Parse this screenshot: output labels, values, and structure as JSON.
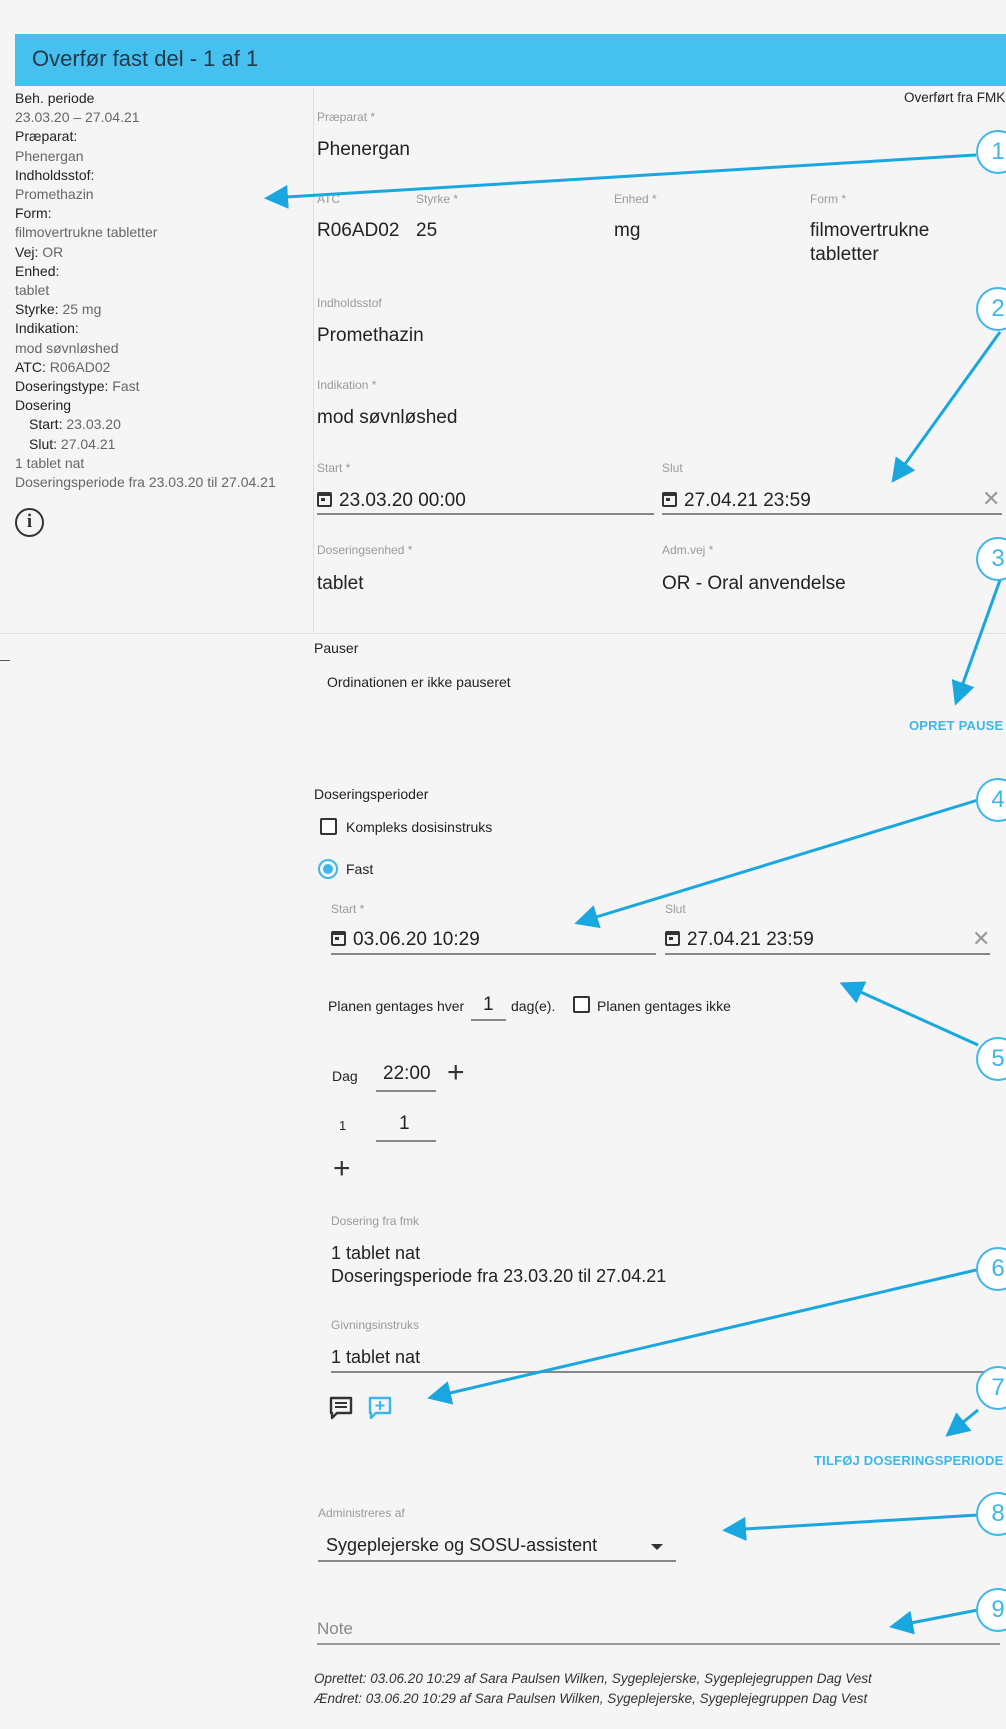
{
  "header": {
    "title": "Overfør fast del - 1 af 1"
  },
  "summary": {
    "beh_periode_label": "Beh. periode",
    "beh_periode_value": "23.03.20 – 27.04.21",
    "praeparat_label": "Præparat:",
    "praeparat_value": "Phenergan",
    "indholdsstof_label": "Indholdsstof:",
    "indholdsstof_value": "Promethazin",
    "form_label": "Form:",
    "form_value": "filmovertrukne tabletter",
    "vej_label": "Vej:",
    "vej_value": "OR",
    "enhed_label": "Enhed:",
    "enhed_value": "tablet",
    "styrke_label": "Styrke:",
    "styrke_value": "25 mg",
    "indikation_label": "Indikation:",
    "indikation_value": "mod søvnløshed",
    "atc_label": "ATC:",
    "atc_value": "R06AD02",
    "doseringstype_label": "Doseringstype:",
    "doseringstype_value": "Fast",
    "dosering_label": "Dosering",
    "start_label": "Start:",
    "start_value": "23.03.20",
    "slut_label": "Slut:",
    "slut_value": "27.04.21",
    "line1": "1 tablet nat",
    "line2": "Doseringsperiode fra 23.03.20 til 27.04.21"
  },
  "form": {
    "source_note": "Overført fra FMK",
    "praeparat_label": "Præparat *",
    "praeparat_value": "Phenergan",
    "atc_label": "ATC",
    "atc_value": "R06AD02",
    "styrke_label": "Styrke *",
    "styrke_value": "25",
    "enhed_label": "Enhed *",
    "enhed_value": "mg",
    "form_label": "Form *",
    "form_value_1": "filmovertrukne",
    "form_value_2": "tabletter",
    "indholdsstof_label": "Indholdsstof",
    "indholdsstof_value": "Promethazin",
    "indikation_label": "Indikation *",
    "indikation_value": "mod søvnløshed",
    "start_label": "Start *",
    "start_value": "23.03.20 00:00",
    "slut_label": "Slut",
    "slut_value": "27.04.21 23:59",
    "doseringsenhed_label": "Doseringsenhed *",
    "doseringsenhed_value": "tablet",
    "admvej_label": "Adm.vej *",
    "admvej_value": "OR - Oral anvendelse"
  },
  "pauser": {
    "heading": "Pauser",
    "status": "Ordinationen er ikke pauseret",
    "button": "OPRET PAUSE"
  },
  "dosering": {
    "heading": "Doseringsperioder",
    "kompleks_label": "Kompleks dosisinstruks",
    "fast_label": "Fast",
    "start_label": "Start *",
    "start_value": "03.06.20 10:29",
    "slut_label": "Slut",
    "slut_value": "27.04.21 23:59",
    "repeat_prefix": "Planen gentages hver",
    "repeat_value": "1",
    "repeat_suffix": "dag(e).",
    "no_repeat_label": "Planen gentages ikke",
    "dag_label": "Dag",
    "time_value": "22:00",
    "row_index": "1",
    "row_amount": "1",
    "fmk_label": "Dosering fra fmk",
    "fmk_line1": "1 tablet nat",
    "fmk_line2": "Doseringsperiode fra 23.03.20 til 27.04.21",
    "givning_label": "Givningsinstruks",
    "givning_value": "1 tablet nat",
    "add_period_button": "TILFØJ DOSERINGSPERIODE"
  },
  "admin": {
    "label": "Administreres af",
    "value": "Sygeplejerske og SOSU-assistent"
  },
  "note": {
    "placeholder": "Note"
  },
  "footer": {
    "created": "Oprettet: 03.06.20 10:29 af Sara Paulsen Wilken, Sygeplejerske, Sygeplejegruppen Dag Vest",
    "changed": "Ændret: 03.06.20 10:29 af Sara Paulsen Wilken, Sygeplejerske, Sygeplejegruppen Dag Vest"
  },
  "callouts": [
    "1",
    "2",
    "3",
    "4",
    "5",
    "6",
    "7",
    "8",
    "9"
  ],
  "colors": {
    "accent": "#45c0ef",
    "link": "#3db7ea",
    "text": "#222222"
  }
}
